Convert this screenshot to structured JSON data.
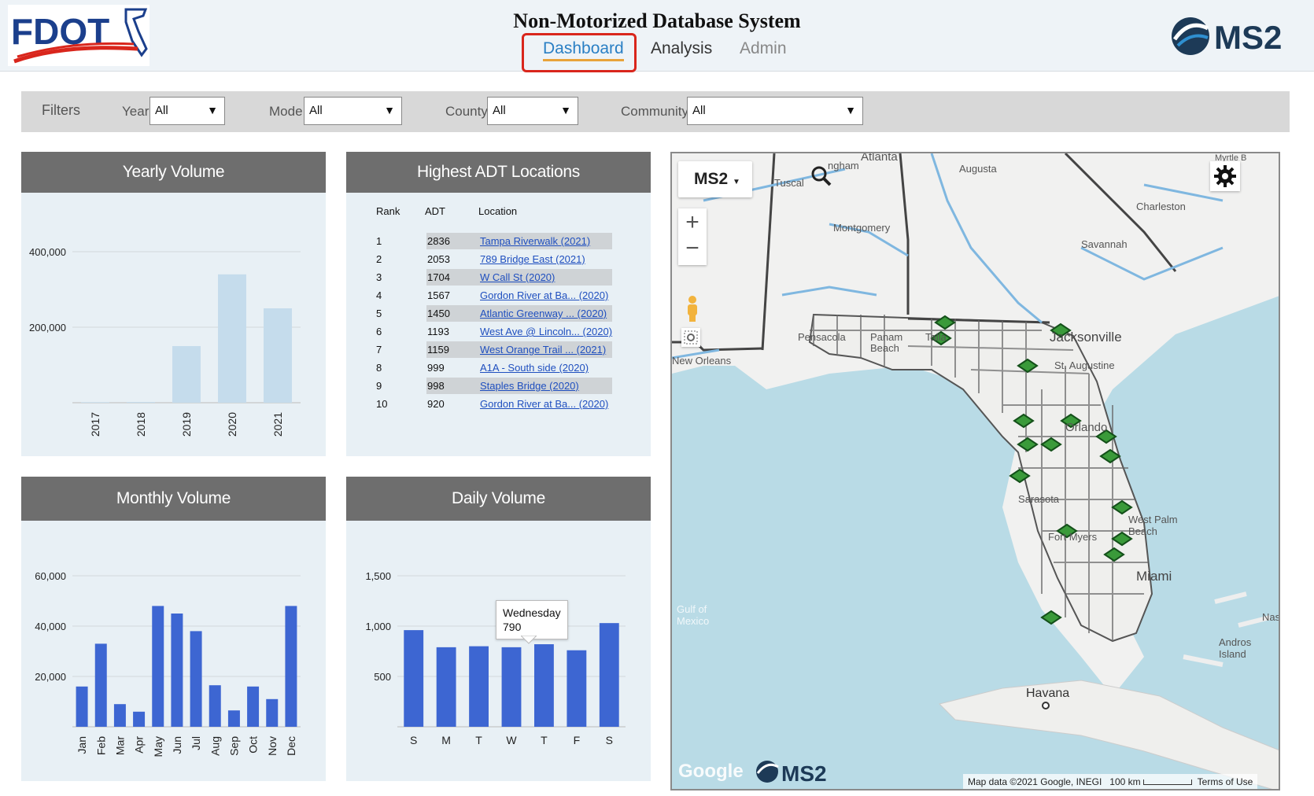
{
  "header": {
    "title": "Non-Motorized Database System",
    "logo_text": "FDOT",
    "brand": "MS2",
    "nav": [
      {
        "label": "Dashboard",
        "active": true
      },
      {
        "label": "Analysis",
        "active": false
      },
      {
        "label": "Admin",
        "active": false
      }
    ]
  },
  "filters": {
    "title": "Filters",
    "fields": [
      {
        "label": "Year",
        "value": "All"
      },
      {
        "label": "Mode",
        "value": "All"
      },
      {
        "label": "County",
        "value": "All"
      },
      {
        "label": "Community",
        "value": "All"
      }
    ]
  },
  "yearly": {
    "title": "Yearly Volume",
    "chart_data": {
      "type": "bar",
      "categories": [
        "2017",
        "2018",
        "2019",
        "2020",
        "2021"
      ],
      "values": [
        1500,
        2000,
        150000,
        340000,
        250000
      ],
      "ylim": [
        0,
        400000
      ],
      "yticks": [
        "200,000",
        "400,000"
      ],
      "color": "#c5dcec"
    }
  },
  "adt": {
    "title": "Highest ADT Locations",
    "columns": [
      "Rank",
      "ADT",
      "Location"
    ],
    "rows": [
      {
        "rank": "1",
        "adt": "2836",
        "location": "Tampa Riverwalk (2021)"
      },
      {
        "rank": "2",
        "adt": "2053",
        "location": "789 Bridge East (2021)"
      },
      {
        "rank": "3",
        "adt": "1704",
        "location": "W Call St (2020)"
      },
      {
        "rank": "4",
        "adt": "1567",
        "location": "Gordon River at Ba... (2020)"
      },
      {
        "rank": "5",
        "adt": "1450",
        "location": "Atlantic Greenway ... (2020)"
      },
      {
        "rank": "6",
        "adt": "1193",
        "location": "West Ave @ Lincoln... (2020)"
      },
      {
        "rank": "7",
        "adt": "1159",
        "location": "West Orange Trail ... (2021)"
      },
      {
        "rank": "8",
        "adt": "999",
        "location": "A1A - South side (2020)"
      },
      {
        "rank": "9",
        "adt": "998",
        "location": "Staples Bridge (2020)"
      },
      {
        "rank": "10",
        "adt": "920",
        "location": "Gordon River at Ba... (2020)"
      }
    ]
  },
  "monthly": {
    "title": "Monthly Volume",
    "chart_data": {
      "type": "bar",
      "categories": [
        "Jan",
        "Feb",
        "Mar",
        "Apr",
        "May",
        "Jun",
        "Jul",
        "Aug",
        "Sep",
        "Oct",
        "Nov",
        "Dec"
      ],
      "values": [
        16000,
        33000,
        9000,
        6000,
        48000,
        45000,
        38000,
        16500,
        6500,
        16000,
        11000,
        48000
      ],
      "ylim": [
        0,
        60000
      ],
      "yticks": [
        "20,000",
        "40,000",
        "60,000"
      ],
      "color": "#3d66d2"
    }
  },
  "daily": {
    "title": "Daily Volume",
    "chart_data": {
      "type": "bar",
      "categories": [
        "S",
        "M",
        "T",
        "W",
        "T",
        "F",
        "S"
      ],
      "values": [
        960,
        790,
        800,
        790,
        820,
        760,
        1030
      ],
      "ylim": [
        0,
        1500
      ],
      "yticks": [
        "500",
        "1,000",
        "1,500"
      ],
      "color": "#3d66d2",
      "tooltip": {
        "day": "Wednesday",
        "value": "790"
      }
    }
  },
  "map": {
    "layer_label": "MS2",
    "places": [
      "Atlanta",
      "Montgomery",
      "Augusta",
      "Charleston",
      "Savannah",
      "Tuscal",
      "ngham",
      "Myrtle B",
      "Pensacola",
      "Panam",
      "Beach",
      "Talla",
      "New Orleans",
      "Jacksonville",
      "St. Augustine",
      "Orlando",
      "Sarasota",
      "Fort Myers",
      "West Palm Beach",
      "Miami",
      "Gulf of Mexico",
      "Havana",
      "Nas",
      "Andros Island"
    ],
    "attribution": "Map data ©2021 Google, INEGI",
    "scale": "100 km",
    "terms": "Terms of Use",
    "google": "Google"
  }
}
